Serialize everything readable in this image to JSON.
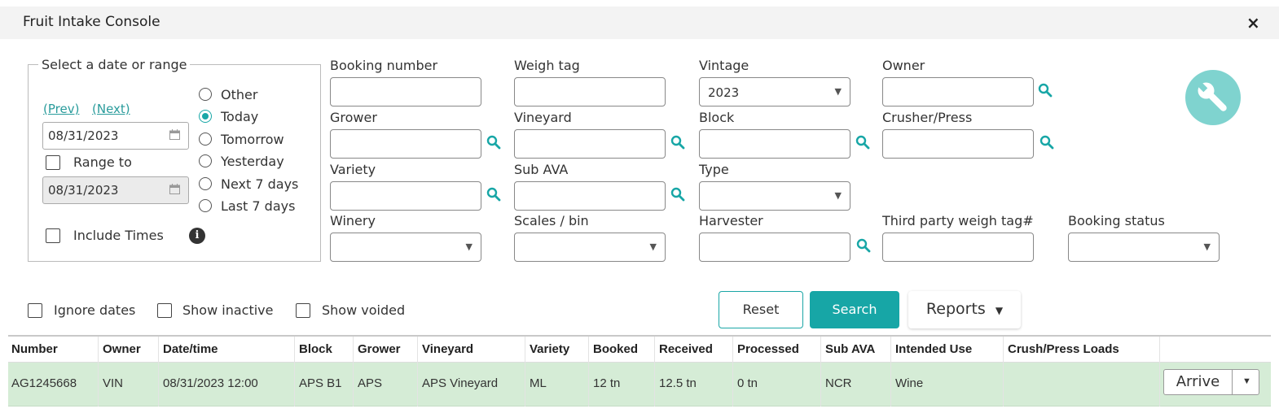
{
  "window": {
    "title": "Fruit Intake Console",
    "close_icon": "×"
  },
  "date_range": {
    "legend": "Select a date or range",
    "prev": "(Prev)",
    "next": "(Next)",
    "date_value": "08/31/2023",
    "range_to_label": "Range to",
    "range_to_value": "08/31/2023",
    "include_times_label": "Include Times",
    "options": [
      {
        "label": "Other",
        "selected": false
      },
      {
        "label": "Today",
        "selected": true
      },
      {
        "label": "Tomorrow",
        "selected": false
      },
      {
        "label": "Yesterday",
        "selected": false
      },
      {
        "label": "Next 7 days",
        "selected": false
      },
      {
        "label": "Last 7 days",
        "selected": false
      }
    ]
  },
  "filters": {
    "booking_number": {
      "label": "Booking number",
      "value": ""
    },
    "weigh_tag": {
      "label": "Weigh tag",
      "value": ""
    },
    "vintage": {
      "label": "Vintage",
      "value": "2023"
    },
    "owner": {
      "label": "Owner",
      "value": ""
    },
    "grower": {
      "label": "Grower",
      "value": ""
    },
    "vineyard": {
      "label": "Vineyard",
      "value": ""
    },
    "block": {
      "label": "Block",
      "value": ""
    },
    "crusher_press": {
      "label": "Crusher/Press",
      "value": ""
    },
    "variety": {
      "label": "Variety",
      "value": ""
    },
    "sub_ava": {
      "label": "Sub AVA",
      "value": ""
    },
    "type": {
      "label": "Type",
      "value": ""
    },
    "winery": {
      "label": "Winery",
      "value": ""
    },
    "scales_bin": {
      "label": "Scales / bin",
      "value": ""
    },
    "harvester": {
      "label": "Harvester",
      "value": ""
    },
    "third_party": {
      "label": "Third party weigh tag#",
      "value": ""
    },
    "booking_status": {
      "label": "Booking status",
      "value": ""
    }
  },
  "options_row": {
    "ignore_dates": "Ignore dates",
    "show_inactive": "Show inactive",
    "show_voided": "Show voided"
  },
  "buttons": {
    "reset": "Reset",
    "search": "Search",
    "reports": "Reports"
  },
  "table": {
    "columns": [
      "Number",
      "Owner",
      "Date/time",
      "Block",
      "Grower",
      "Vineyard",
      "Variety",
      "Booked",
      "Received",
      "Processed",
      "Sub AVA",
      "Intended Use",
      "Crush/Press Loads"
    ],
    "rows": [
      [
        "AG1245668",
        "VIN",
        "08/31/2023 12:00",
        "APS B1",
        "APS",
        "APS Vineyard",
        "ML",
        "12 tn",
        "12.5 tn",
        "0 tn",
        "NCR",
        "Wine",
        ""
      ]
    ],
    "row_action": "Arrive"
  },
  "colors": {
    "accent": "#17a6a6",
    "row_highlight": "#d5ecd6",
    "wrench_bg": "#7fd3cf"
  }
}
